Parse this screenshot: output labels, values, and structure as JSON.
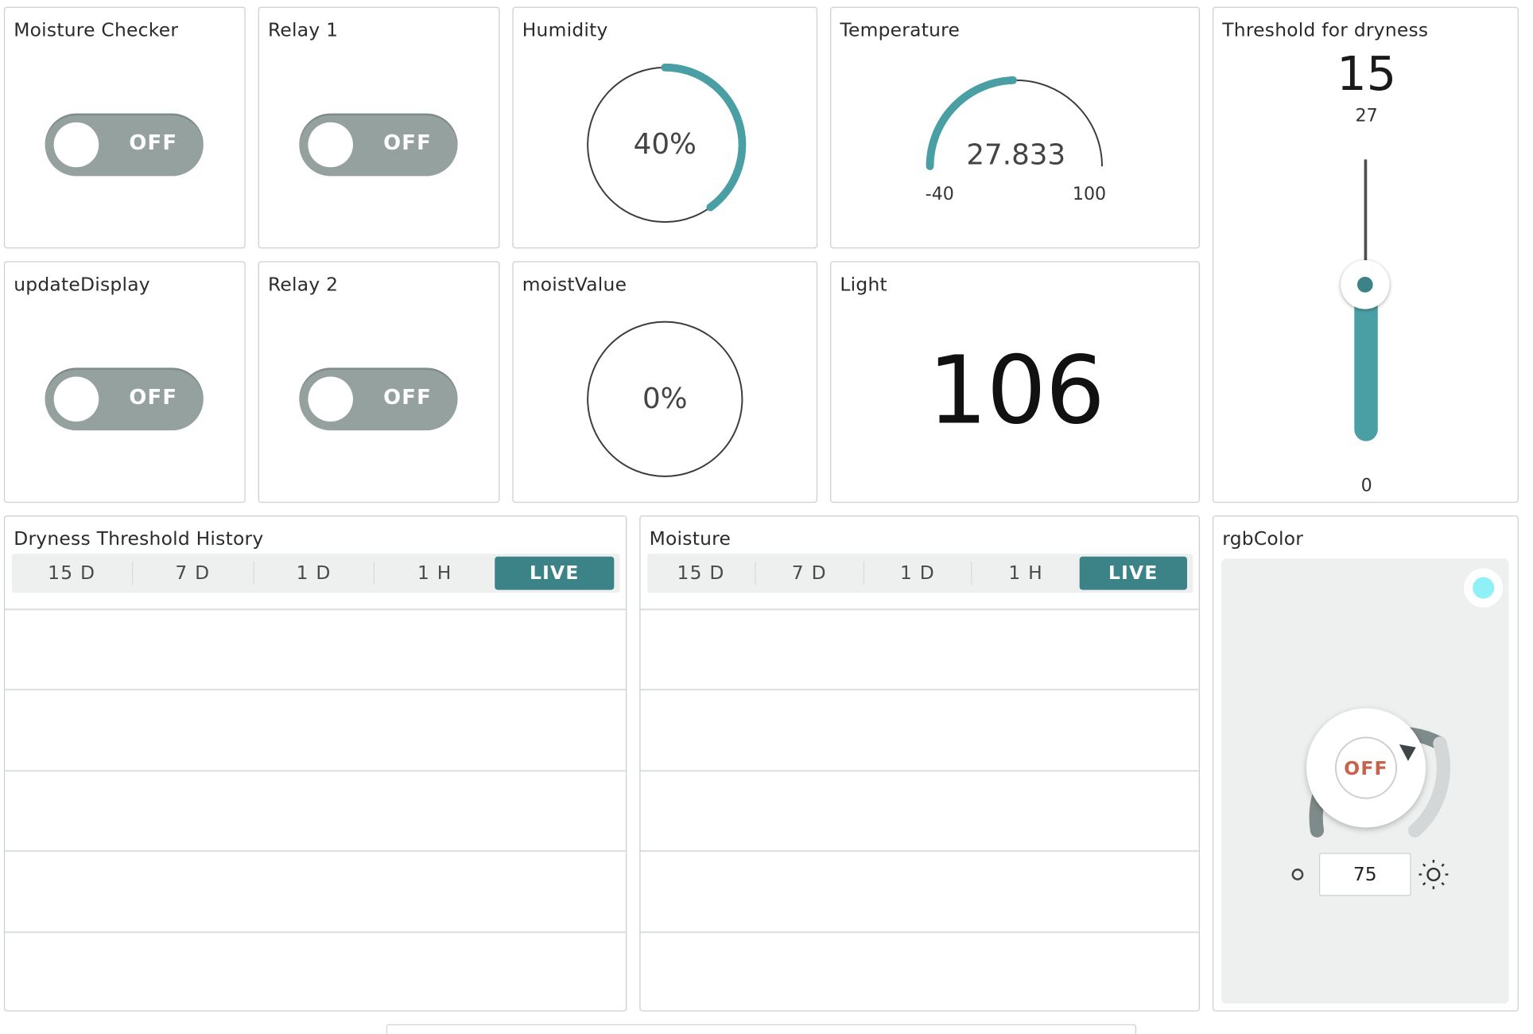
{
  "widgets": {
    "moisture_checker": {
      "title": "Moisture Checker",
      "state": "OFF"
    },
    "relay1": {
      "title": "Relay 1",
      "state": "OFF"
    },
    "update_display": {
      "title": "updateDisplay",
      "state": "OFF"
    },
    "relay2": {
      "title": "Relay 2",
      "state": "OFF"
    },
    "humidity": {
      "title": "Humidity",
      "value_text": "40%",
      "fraction": 0.4
    },
    "moist_value": {
      "title": "moistValue",
      "value_text": "0%",
      "fraction": 0
    },
    "temperature": {
      "title": "Temperature",
      "value": "27.833",
      "min": "-40",
      "max": "100"
    },
    "light": {
      "title": "Light",
      "value": "106"
    },
    "threshold": {
      "title": "Threshold for dryness",
      "value": "15",
      "max": "27",
      "min": "0",
      "fraction": 0.56
    },
    "dryness_history": {
      "title": "Dryness Threshold History",
      "tabs": [
        "15 D",
        "7 D",
        "1 D",
        "1 H",
        "LIVE"
      ]
    },
    "moisture_chart": {
      "title": "Moisture",
      "tabs": [
        "15 D",
        "7 D",
        "1 D",
        "1 H",
        "LIVE"
      ]
    },
    "rgb_color": {
      "title": "rgbColor",
      "dimmer_state": "OFF",
      "brightness": "75",
      "swatch_color": "#8ff0f5"
    }
  },
  "colors": {
    "accent": "#4a9fa5",
    "tab_active": "#3b8387",
    "switch_off": "#95a19f",
    "off_text": "#c8604a"
  }
}
